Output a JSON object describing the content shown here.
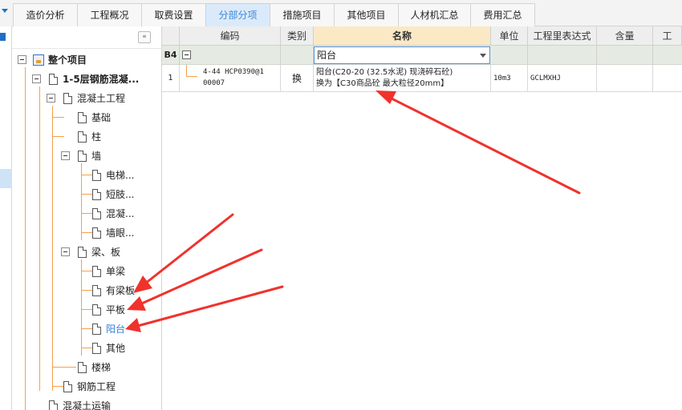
{
  "tabs": [
    {
      "label": "造价分析"
    },
    {
      "label": "工程概况"
    },
    {
      "label": "取费设置"
    },
    {
      "label": "分部分项",
      "active": true
    },
    {
      "label": "措施项目"
    },
    {
      "label": "其他项目"
    },
    {
      "label": "人材机汇总"
    },
    {
      "label": "费用汇总"
    }
  ],
  "tree": {
    "collapse_glyph": "«",
    "items": [
      {
        "label": "整个项目"
      },
      {
        "label": "1-5层钢筋混凝..."
      },
      {
        "label": "混凝土工程"
      },
      {
        "label": "基础"
      },
      {
        "label": "柱"
      },
      {
        "label": "墙"
      },
      {
        "label": "电梯..."
      },
      {
        "label": "短肢..."
      },
      {
        "label": "混凝..."
      },
      {
        "label": "墙眼..."
      },
      {
        "label": "梁、板"
      },
      {
        "label": "单梁"
      },
      {
        "label": "有梁板"
      },
      {
        "label": "平板"
      },
      {
        "label": "阳台",
        "selected": true
      },
      {
        "label": "其他"
      },
      {
        "label": "楼梯"
      },
      {
        "label": "钢筋工程"
      },
      {
        "label": "混凝土运输"
      }
    ]
  },
  "grid": {
    "headers": [
      "编码",
      "类别",
      "名称",
      "单位",
      "工程里表达式",
      "含量",
      "工"
    ],
    "group_row": {
      "id": "B4",
      "name": "阳台"
    },
    "rows": [
      {
        "index": "1",
        "code_line1": "4-44  HCP0390@1",
        "code_line2": "00007",
        "category": "换",
        "name_line1": "阳台(C20-20 (32.5水泥) 现浇碎石砼)",
        "name_line2": "换为【C30商品砼 最大粒径20mm】",
        "unit": "10m3",
        "expr": "GCLMXHJ",
        "content": ""
      }
    ]
  },
  "colors": {
    "accent": "#3a86d6",
    "tree_line": "#f5a04a",
    "annotation_arrow": "#f0322c",
    "name_header": "#fbe9c5"
  }
}
